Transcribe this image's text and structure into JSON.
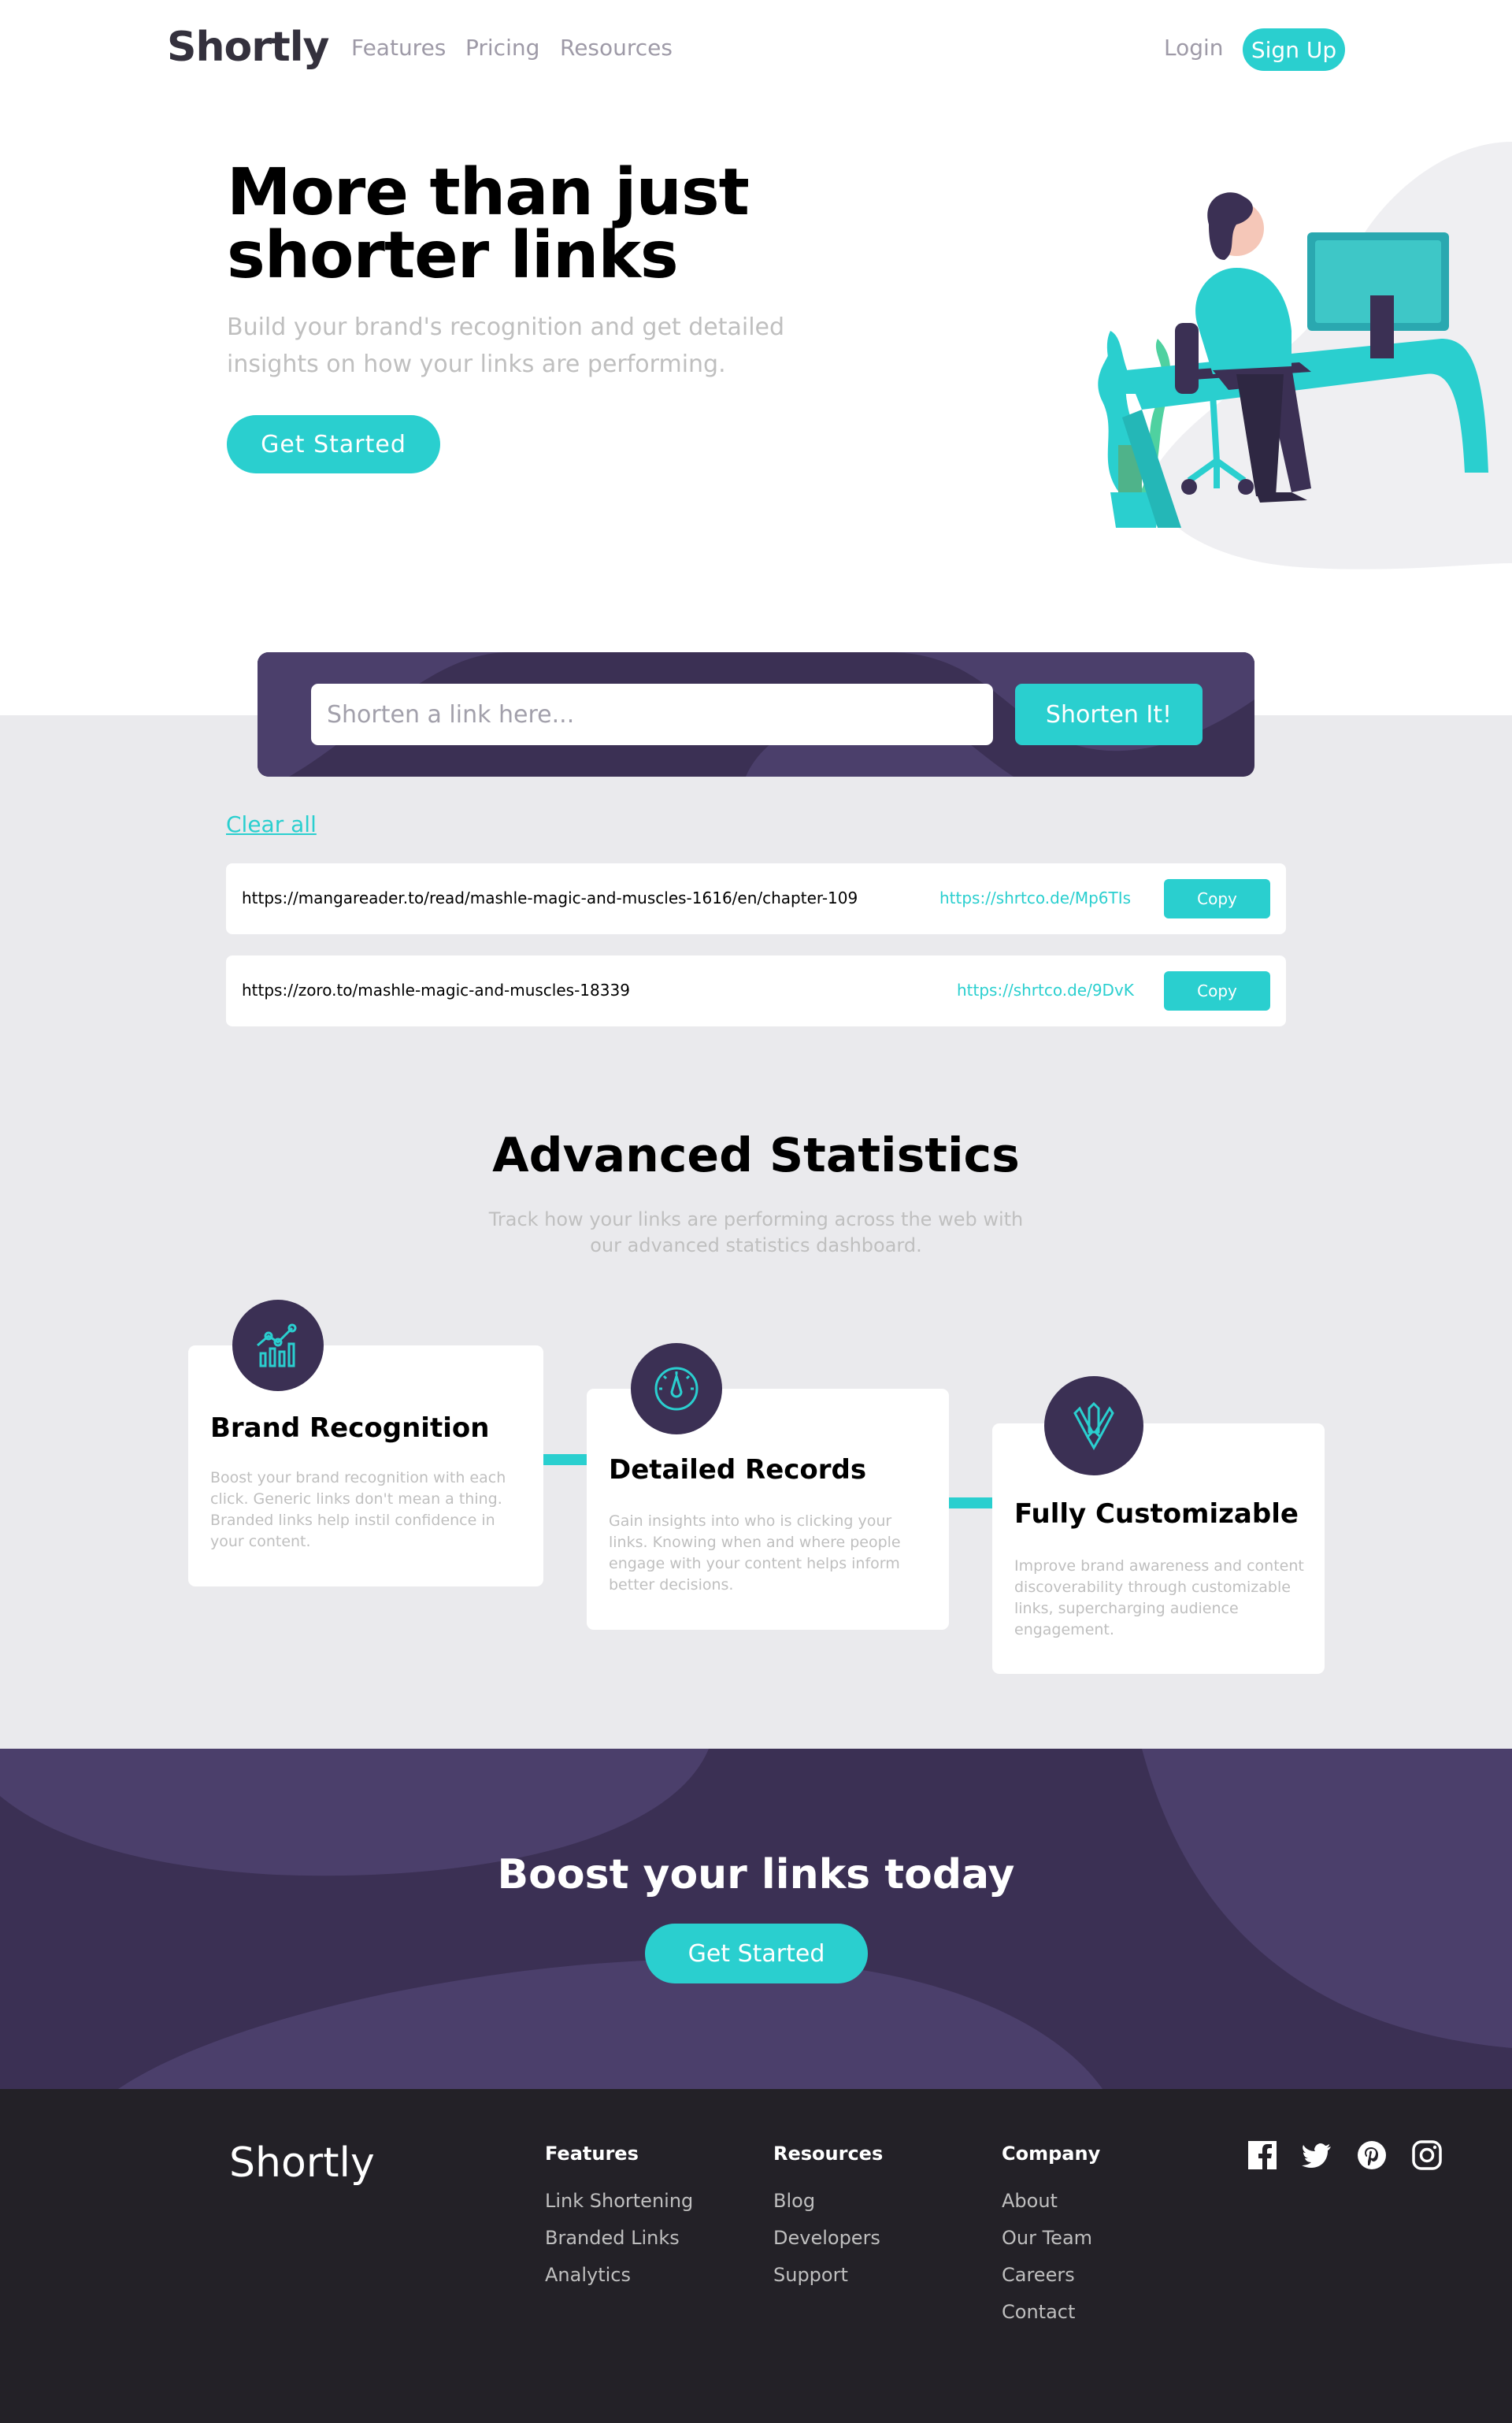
{
  "nav": {
    "logo": "Shortly",
    "links": [
      "Features",
      "Pricing",
      "Resources"
    ],
    "login": "Login",
    "signup": "Sign Up"
  },
  "hero": {
    "title_line1": "More than just",
    "title_line2": "shorter links",
    "subtitle": "Build your brand's recognition and get detailed insights on how your links are performing.",
    "cta": "Get Started"
  },
  "shorten": {
    "placeholder": "Shorten a link here...",
    "button": "Shorten It!",
    "clear_all": "Clear all"
  },
  "results": [
    {
      "long": "https://mangareader.to/read/mashle-magic-and-muscles-1616/en/chapter-109",
      "short": "https://shrtco.de/Mp6TIs",
      "copy": "Copy"
    },
    {
      "long": "https://zoro.to/mashle-magic-and-muscles-18339",
      "short": "https://shrtco.de/9DvK",
      "copy": "Copy"
    }
  ],
  "stats": {
    "title": "Advanced Statistics",
    "subtitle": "Track how your links are performing across the web with our advanced statistics dashboard.",
    "cards": [
      {
        "icon": "chart-icon",
        "title": "Brand Recognition",
        "text": "Boost your brand recognition with each click. Generic links don't mean a thing. Branded links help instil confidence in your content."
      },
      {
        "icon": "gauge-icon",
        "title": "Detailed Records",
        "text": "Gain insights into who is clicking your links. Knowing when and where people engage with your content helps inform better decisions."
      },
      {
        "icon": "tools-icon",
        "title": "Fully Customizable",
        "text": "Improve brand awareness and content discoverability through customizable links, supercharging audience engagement."
      }
    ]
  },
  "boost": {
    "title": "Boost your links today",
    "cta": "Get Started"
  },
  "footer": {
    "logo": "Shortly",
    "columns": [
      {
        "title": "Features",
        "links": [
          "Link Shortening",
          "Branded Links",
          "Analytics"
        ]
      },
      {
        "title": "Resources",
        "links": [
          "Blog",
          "Developers",
          "Support"
        ]
      },
      {
        "title": "Company",
        "links": [
          "About",
          "Our Team",
          "Careers",
          "Contact"
        ]
      }
    ],
    "social": [
      "facebook-icon",
      "twitter-icon",
      "pinterest-icon",
      "instagram-icon"
    ]
  },
  "colors": {
    "accent": "#2acfcf",
    "dark_violet": "#3b3054",
    "footer_bg": "#232127",
    "gray_bg": "#eaeaed"
  }
}
